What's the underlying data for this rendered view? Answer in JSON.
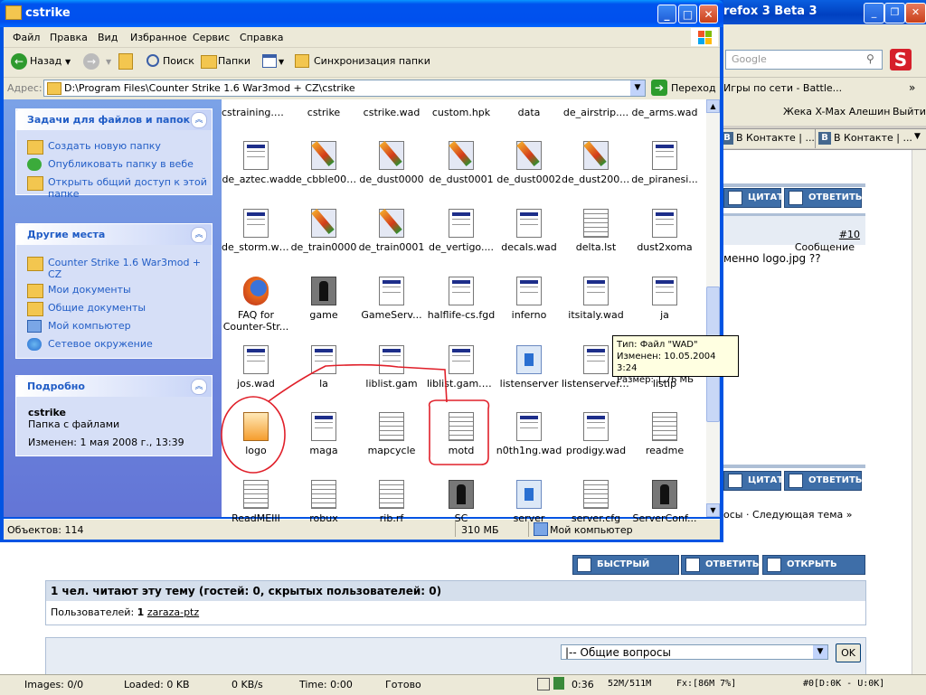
{
  "firefox": {
    "title": "refox 3 Beta 3",
    "search_placeholder": "Google",
    "bookmark": "Игры по сети - Battle...",
    "user_name": "Жека X-Max Алешин",
    "logout": "Выйти",
    "tabs": [
      "В Контакте | ...",
      "В Контакте | ..."
    ],
    "forum": {
      "quote_btn": "ЦИТАТА",
      "reply_btn": "ОТВЕТИТЬ",
      "message_label": "Сообщение",
      "message_num": "#10",
      "message_text": "менно logo.jpg ??",
      "next_topic": "осы · Следующая тема »",
      "quick_reply": "БЫСТРЫЙ ОТВЕТ",
      "reply": "ОТВЕТИТЬ",
      "open_topic": "ОТКРЫТЬ ТЕМУ",
      "readers_header": "1 чел. читают эту тему (гостей: 0, скрытых пользователей: 0)",
      "users_label": "Пользователей:",
      "users_count": "1",
      "users_name": "zaraza-ptz",
      "jump_value": "|-- Общие вопросы",
      "ok": "OK"
    },
    "status": {
      "images": "Images: 0/0",
      "loaded": "Loaded: 0 KB",
      "speed": "0 KB/s",
      "time": "Time: 0:00",
      "ready": "Готово",
      "timer": "0:36",
      "mem": "52M/511M",
      "fx": "Fx:[86M  7%]",
      "tags": "#0[D:0K - U:0K]"
    }
  },
  "explorer": {
    "title": "cstrike",
    "menu": [
      "Файл",
      "Правка",
      "Вид",
      "Избранное",
      "Сервис",
      "Справка"
    ],
    "toolbar": {
      "back": "Назад",
      "search": "Поиск",
      "folders": "Папки",
      "sync": "Синхронизация папки"
    },
    "address_label": "Адрес:",
    "address": "D:\\Program Files\\Counter Strike 1.6 War3mod + CZ\\cstrike",
    "go": "Переход",
    "tasks": {
      "title": "Задачи для файлов и папок",
      "items": [
        "Создать новую папку",
        "Опубликовать папку в вебе",
        "Открыть общий доступ к этой папке"
      ]
    },
    "places": {
      "title": "Другие места",
      "items": [
        "Counter Strike 1.6 War3mod + CZ",
        "Мои документы",
        "Общие документы",
        "Мой компьютер",
        "Сетевое окружение"
      ]
    },
    "details": {
      "title": "Подробно",
      "name": "cstrike",
      "type": "Папка с файлами",
      "modified": "Изменен: 1 мая 2008 г., 13:39"
    },
    "files": [
      [
        "cstraining.wad",
        "cstrike",
        "cstrike.wad",
        "custom.hpk",
        "data",
        "de_airstrip....",
        "de_arms.wad"
      ],
      [
        "de_aztec.wad",
        "de_cbble0000",
        "de_dust0000",
        "de_dust0001",
        "de_dust0002",
        "de_dust20000",
        "de_piranesi..."
      ],
      [
        "de_storm.wad",
        "de_train0000",
        "de_train0001",
        "de_vertigo....",
        "decals.wad",
        "delta.lst",
        "dust2xoma"
      ],
      [
        "FAQ for Counter-Str...",
        "game",
        "GameServ...",
        "halflife-cs.fgd",
        "inferno",
        "itsitaly.wad",
        "ja"
      ],
      [
        "jos.wad",
        "la",
        "liblist.gam",
        "liblist.gam.o...",
        "listenserver",
        "listenserver....",
        "listip"
      ],
      [
        "logo",
        "maga",
        "mapcycle",
        "motd",
        "n0th1ng.wad",
        "prodigy.wad",
        "readme"
      ],
      [
        "ReadMEIII",
        "robux",
        "rib.rf",
        "SC",
        "server",
        "server.cfg",
        "ServerConf..."
      ]
    ],
    "tooltip": {
      "type": "Тип: Файл \"WAD\"",
      "modified": "Изменен: 10.05.2004 3:24",
      "size": "Размер: 1,76 МБ"
    },
    "status": {
      "objects": "Объектов: 114",
      "size": "310 МБ",
      "location": "Мой компьютер"
    }
  },
  "colors": {
    "xp_title": "#0054e3",
    "task_link": "#215dc6",
    "annotation": "#e0202a"
  }
}
